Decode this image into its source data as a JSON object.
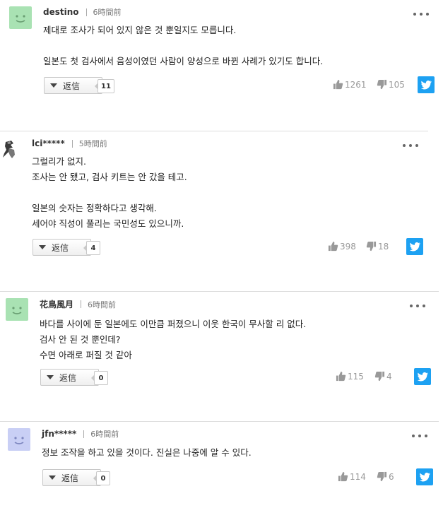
{
  "comments": [
    {
      "author": "destino",
      "time": "6時間前",
      "avatar_color": "#a9e2b3",
      "lines": [
        "제대로 조사가 되어 있지 않은 것 뿐일지도 모릅니다.",
        "",
        "일본도 첫 검사에서 음성이였던 사람이 양성으로 바뀐 사례가 있기도 합니다."
      ],
      "reply_label": "返信",
      "reply_count": "11",
      "likes": "1261",
      "dislikes": "105"
    },
    {
      "author": "lci*****",
      "time": "5時間前",
      "avatar_color": "#ffffff",
      "lines": [
        "그럴리가 없지.",
        "조사는 안 됐고, 검사 키트는 안 갔을 테고.",
        "",
        "일본의 숫자는 정확하다고 생각해.",
        "세어야 직성이 풀리는 국민성도 있으니까."
      ],
      "reply_label": "返信",
      "reply_count": "4",
      "likes": "398",
      "dislikes": "18"
    },
    {
      "author": "花鳥風月",
      "time": "6時間前",
      "avatar_color": "#a9e2b3",
      "lines": [
        "바다를 사이에 둔 일본에도 이만큼 퍼졌으니 이웃 한국이 무사할 리 없다.",
        "검사 안 된 것 뿐인데?",
        "수면 아래로 퍼질 것 같아"
      ],
      "reply_label": "返信",
      "reply_count": "0",
      "likes": "115",
      "dislikes": "4"
    },
    {
      "author": "jfn*****",
      "time": "6時間前",
      "avatar_color": "#c9cff5",
      "lines": [
        "정보 조작을 하고 있을 것이다. 진실은 나중에 알 수 있다."
      ],
      "reply_label": "返信",
      "reply_count": "0",
      "likes": "114",
      "dislikes": "6"
    }
  ]
}
